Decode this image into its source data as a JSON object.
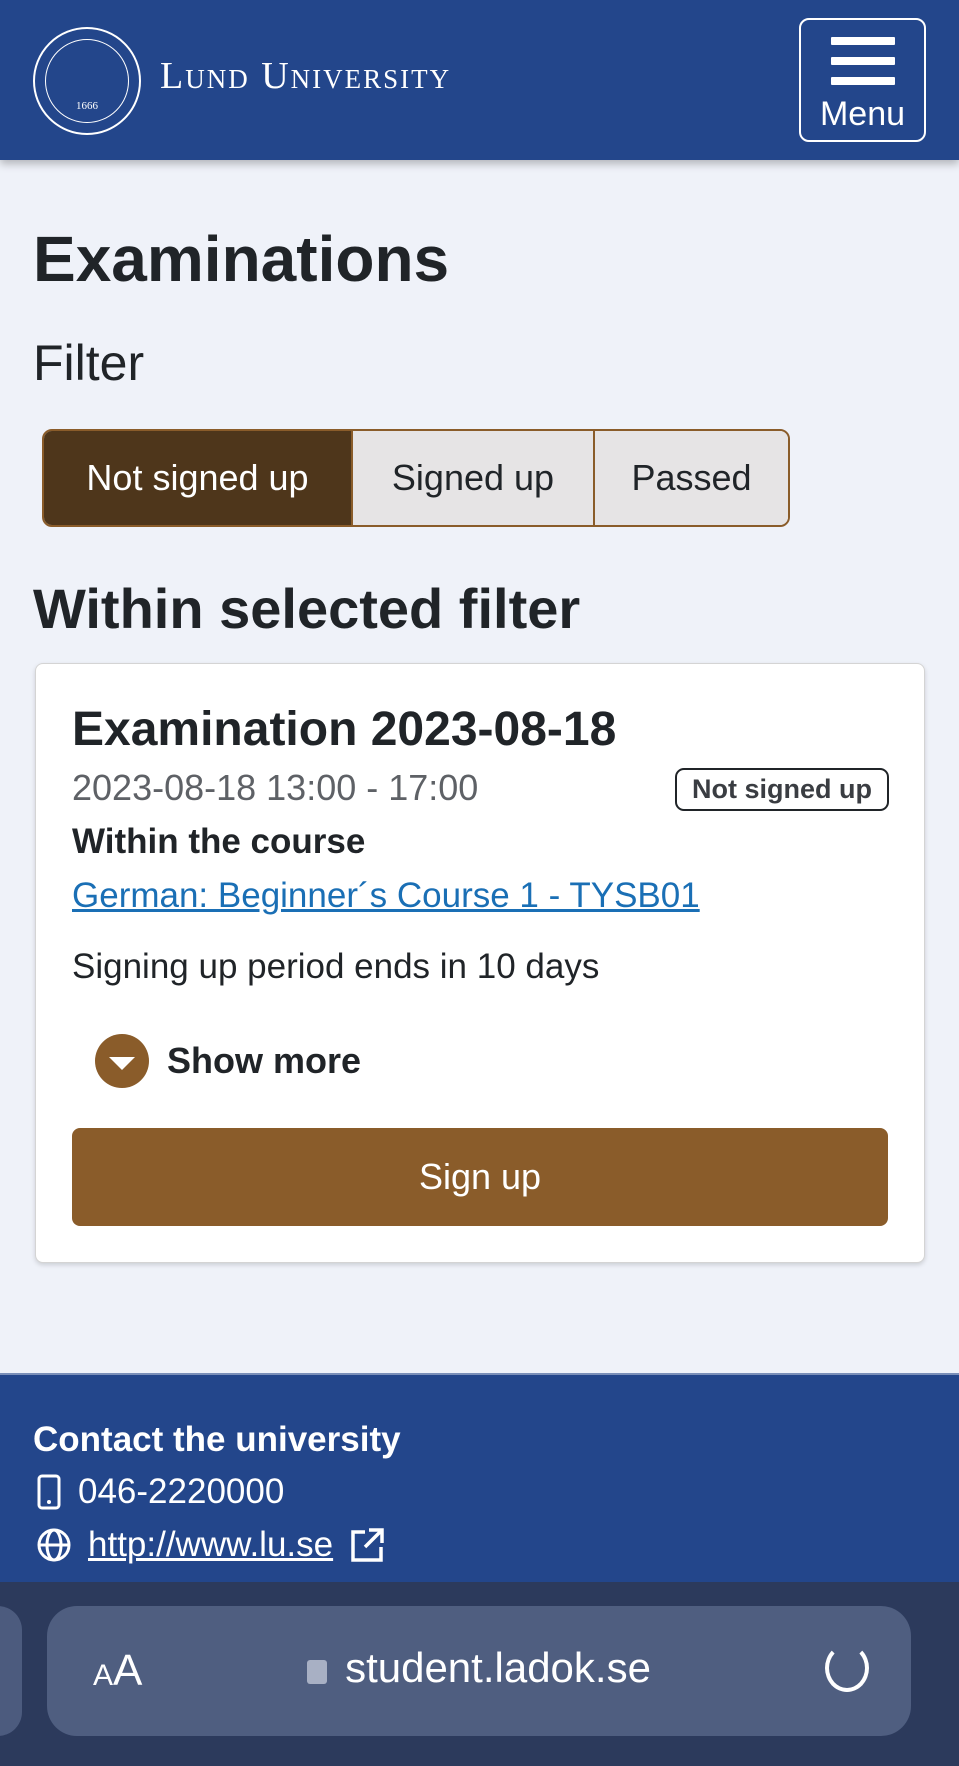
{
  "header": {
    "logo_text": "Lund University",
    "seal_text": "1666",
    "menu_label": "Menu"
  },
  "page": {
    "title": "Examinations",
    "filter_label": "Filter",
    "filters": [
      {
        "label": "Not signed up",
        "selected": true
      },
      {
        "label": "Signed up",
        "selected": false
      },
      {
        "label": "Passed",
        "selected": false
      }
    ],
    "section_title": "Within selected filter"
  },
  "exam": {
    "title": "Examination 2023-08-18",
    "datetime": "2023-08-18 13:00 - 17:00",
    "status": "Not signed up",
    "course_heading": "Within the course",
    "course_link": "German: Beginner´s Course 1 - TYSB01",
    "signup_period": "Signing up period ends in 10 days",
    "show_more": "Show more",
    "signup_button": "Sign up"
  },
  "footer": {
    "heading": "Contact the university",
    "phone": "046-2220000",
    "website": "http://www.lu.se"
  },
  "browser": {
    "text_size_label": "AA",
    "url": "student.ladok.se"
  },
  "colors": {
    "brand_blue": "#23468b",
    "accent_brown": "#8a5c2a",
    "selected_brown": "#4e361b",
    "link": "#1a6fb5"
  }
}
